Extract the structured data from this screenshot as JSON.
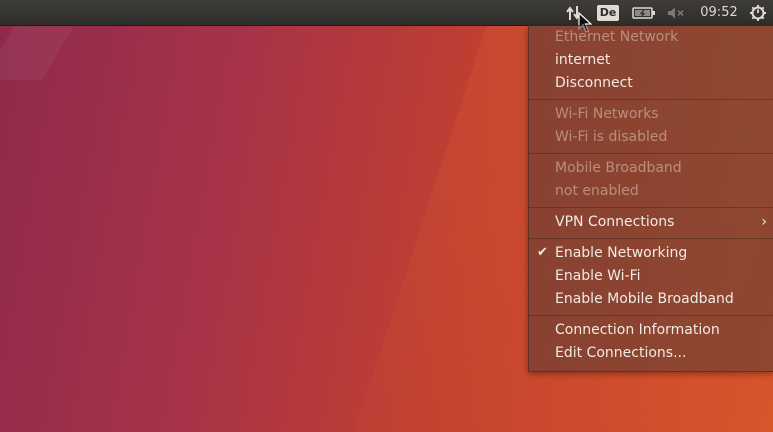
{
  "topbar": {
    "network_icon": "network-updown-icon",
    "keyboard_layout": "De",
    "battery_icon": "battery-icon",
    "sound_icon": "sound-muted-icon",
    "clock": "09:52",
    "session_icon": "gear-icon"
  },
  "menu": {
    "ethernet_header": "Ethernet Network",
    "ethernet_connection": "internet",
    "disconnect": "Disconnect",
    "wifi_header": "Wi-Fi Networks",
    "wifi_status": "Wi-Fi is disabled",
    "mobile_header": "Mobile Broadband",
    "mobile_status": "not enabled",
    "vpn": "VPN Connections",
    "enable_networking": "Enable Networking",
    "enable_networking_checked": "✔",
    "enable_wifi": "Enable Wi-Fi",
    "enable_mobile": "Enable Mobile Broadband",
    "connection_info": "Connection Information",
    "edit_connections": "Edit Connections..."
  }
}
